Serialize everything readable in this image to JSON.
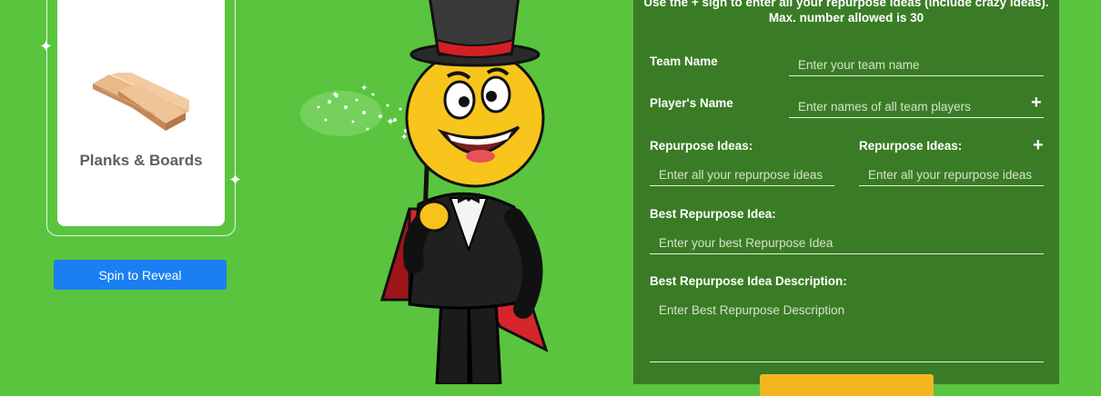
{
  "card": {
    "label": "Planks & Boards",
    "icon": "planks-boards-icon"
  },
  "spin_button": {
    "label": "Spin to Reveal"
  },
  "mascot": {
    "name": "magician-emoji-mascot"
  },
  "form": {
    "intro": "Use the + sign to enter all your repurpose ideas (include crazy ideas). Max. number allowed is 30",
    "team_name": {
      "label": "Team Name",
      "placeholder": "Enter your team name"
    },
    "players": {
      "label": "Player's Name",
      "placeholder": "Enter names of all team players"
    },
    "ideas_1": {
      "label": "Repurpose Ideas:",
      "placeholder": "Enter all your repurpose ideas"
    },
    "ideas_2": {
      "label": "Repurpose Ideas:",
      "placeholder": "Enter all your repurpose ideas"
    },
    "best_idea": {
      "label": "Best Repurpose Idea:",
      "placeholder": "Enter your best Repurpose Idea"
    },
    "description": {
      "label": "Best Repurpose Idea Description:",
      "placeholder": "Enter Best Repurpose Description"
    },
    "plus_symbol": "+"
  },
  "colors": {
    "background": "#5ac43f",
    "panel": "#3a7c25",
    "button": "#1a7ff2",
    "submit": "#f4b61f"
  }
}
